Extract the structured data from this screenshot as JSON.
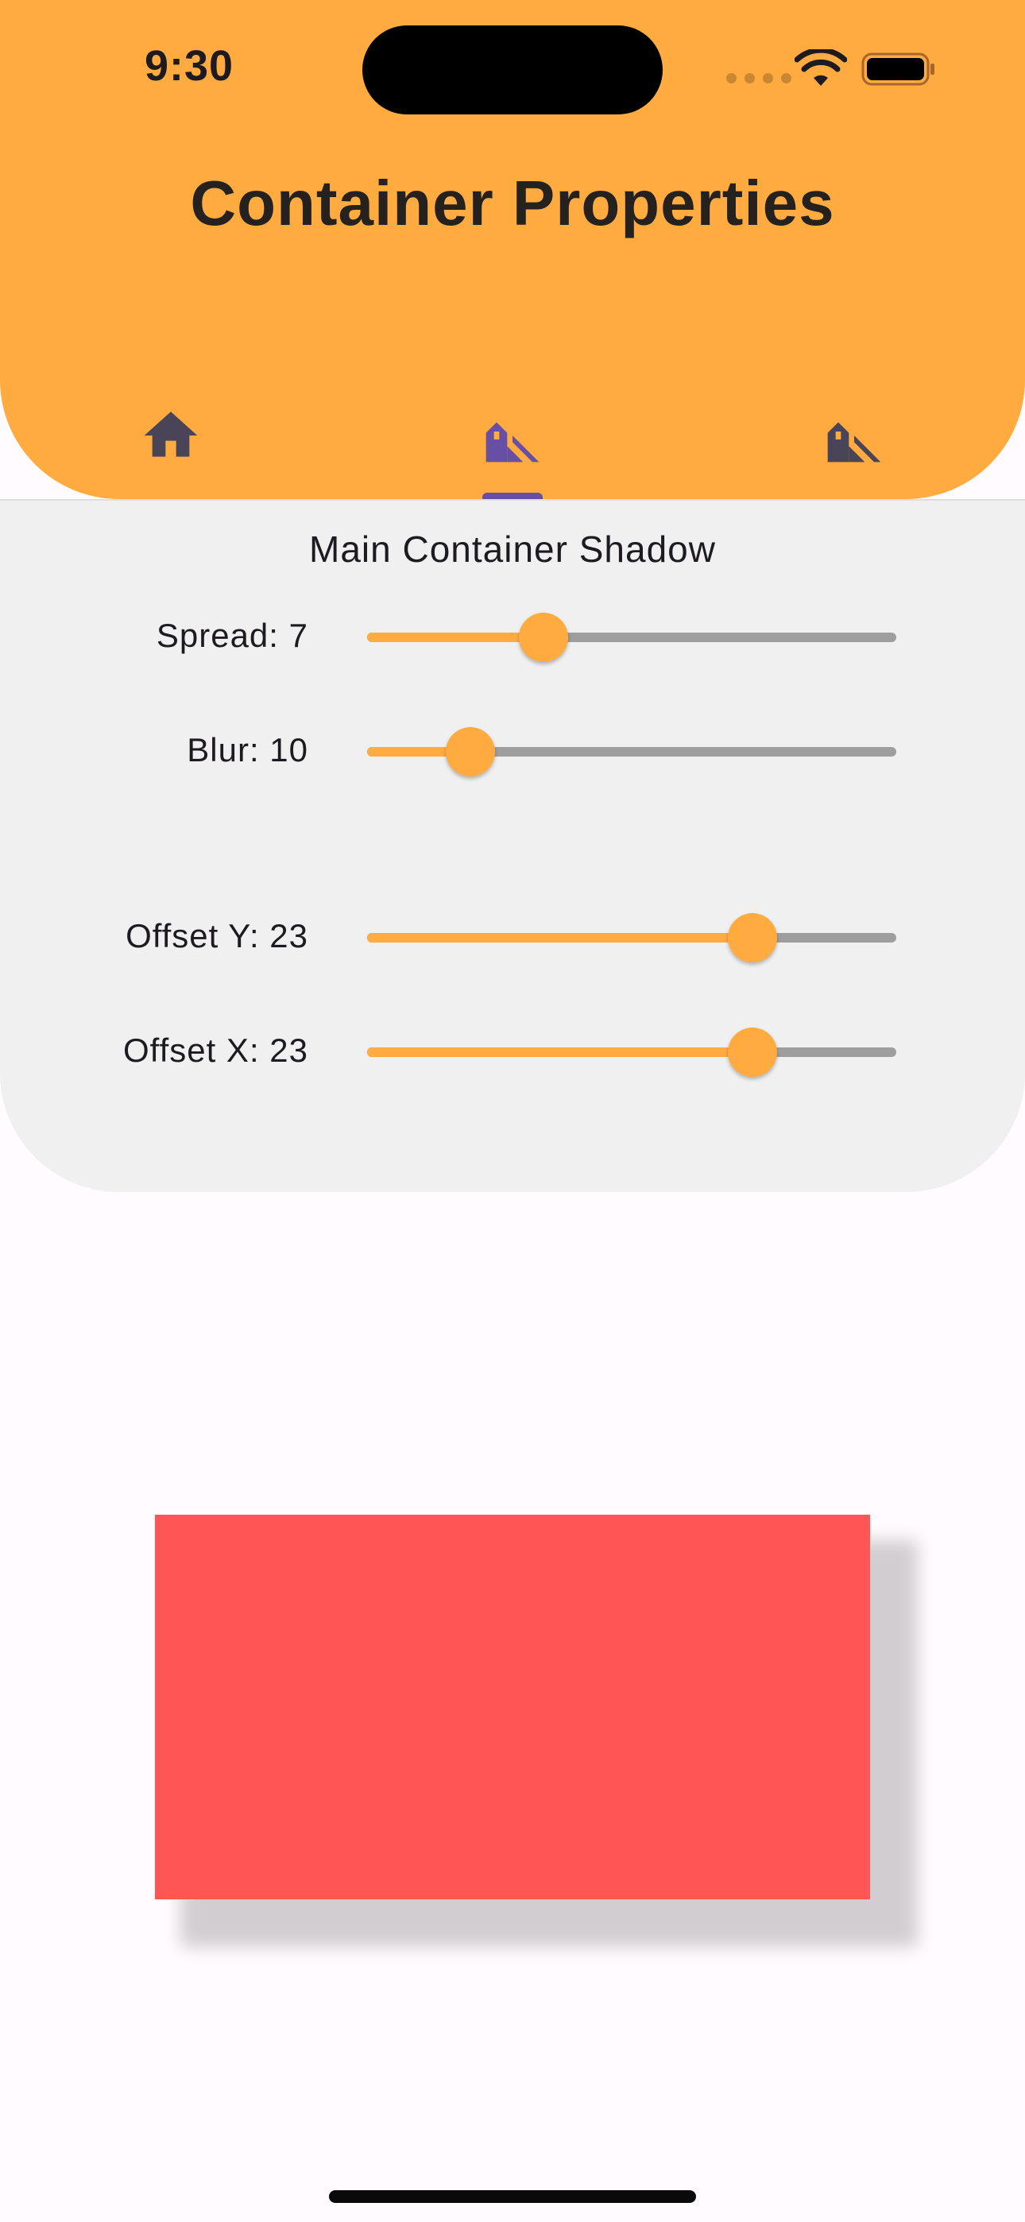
{
  "status_bar": {
    "time": "9:30"
  },
  "app_bar": {
    "title": "Container Properties",
    "accent_color": "#ffab40",
    "tabs": [
      {
        "icon": "home-icon",
        "selected": false
      },
      {
        "icon": "house-shadow-icon",
        "selected": true
      },
      {
        "icon": "house-shadow-icon",
        "selected": false
      }
    ],
    "indicator_color": "#6750a4"
  },
  "panel": {
    "title": "Main Container Shadow",
    "sliders": [
      {
        "label": "Spread: 7",
        "fraction": 0.333
      },
      {
        "label": "Blur: 10",
        "fraction": 0.195
      },
      {
        "label": "Offset Y: 23",
        "fraction": 0.728
      },
      {
        "label": "Offset X: 23",
        "fraction": 0.728
      }
    ]
  },
  "preview": {
    "color": "#ff5555"
  }
}
